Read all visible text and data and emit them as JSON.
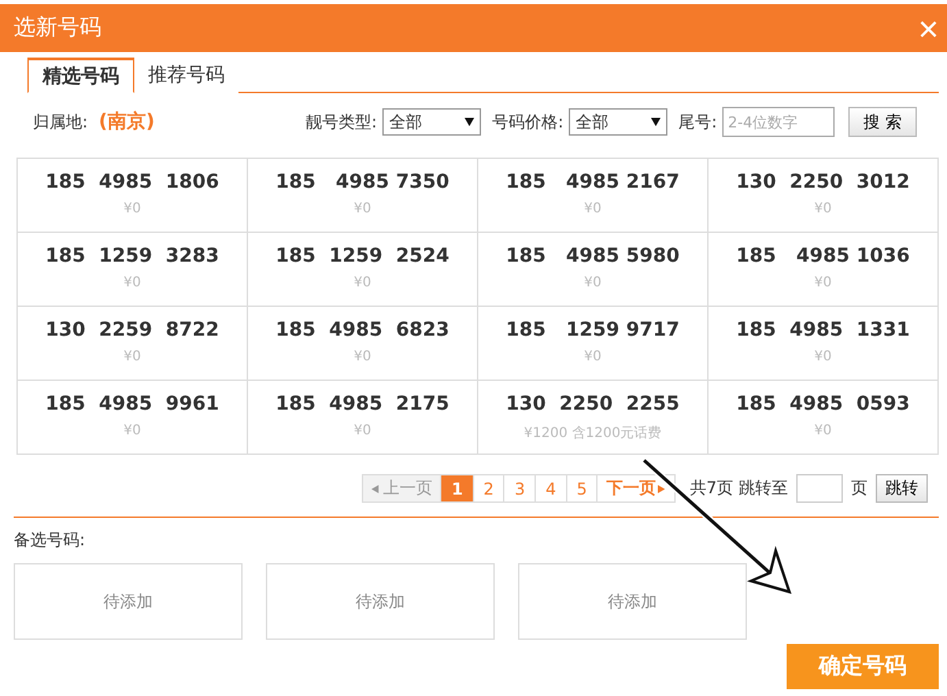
{
  "window": {
    "title": "选新号码",
    "close": "×"
  },
  "tabs": [
    {
      "label": "精选号码",
      "selected": true
    },
    {
      "label": "推荐号码",
      "selected": false
    }
  ],
  "filters": {
    "location_label": "归属地:",
    "location": "(南京)",
    "type_label": "靓号类型:",
    "type_value": "全部",
    "price_label": "号码价格:",
    "price_value": "全部",
    "tail_label": "尾号:",
    "tail_placeholder": "2-4位数字",
    "search_button": "搜 索"
  },
  "numbers": [
    {
      "number": "185  4985  1806",
      "price": "¥0"
    },
    {
      "number": "185   4985 7350",
      "price": "¥0"
    },
    {
      "number": "185   4985 2167",
      "price": "¥0"
    },
    {
      "number": "130  2250  3012",
      "price": "¥0"
    },
    {
      "number": "185  1259  3283",
      "price": "¥0"
    },
    {
      "number": "185  1259  2524",
      "price": "¥0"
    },
    {
      "number": "185   4985 5980",
      "price": "¥0"
    },
    {
      "number": "185   4985 1036",
      "price": "¥0"
    },
    {
      "number": "130  2259  8722",
      "price": "¥0"
    },
    {
      "number": "185  4985  6823",
      "price": "¥0"
    },
    {
      "number": "185   1259 9717",
      "price": "¥0"
    },
    {
      "number": "185  4985  1331",
      "price": "¥0"
    },
    {
      "number": "185  4985  9961",
      "price": "¥0"
    },
    {
      "number": "185  4985  2175",
      "price": "¥0"
    },
    {
      "number": "130  2250  2255",
      "price": "¥1200 含1200元话费"
    },
    {
      "number": "185  4985  0593",
      "price": "¥0"
    }
  ],
  "pagination": {
    "prev": "上一页",
    "pages": [
      {
        "label": "1",
        "selected": true
      },
      {
        "label": "2",
        "selected": false
      },
      {
        "label": "3",
        "selected": false
      },
      {
        "label": "4",
        "selected": false
      },
      {
        "label": "5",
        "selected": false
      }
    ],
    "next": "下一页",
    "total": "共7页",
    "jump_label": "跳转至",
    "page_unit": "页",
    "jump_button": "跳转"
  },
  "selected_section": {
    "label": "备选号码:",
    "slots": [
      "待添加",
      "待添加",
      "待添加"
    ]
  },
  "confirm_button": "确定号码"
}
